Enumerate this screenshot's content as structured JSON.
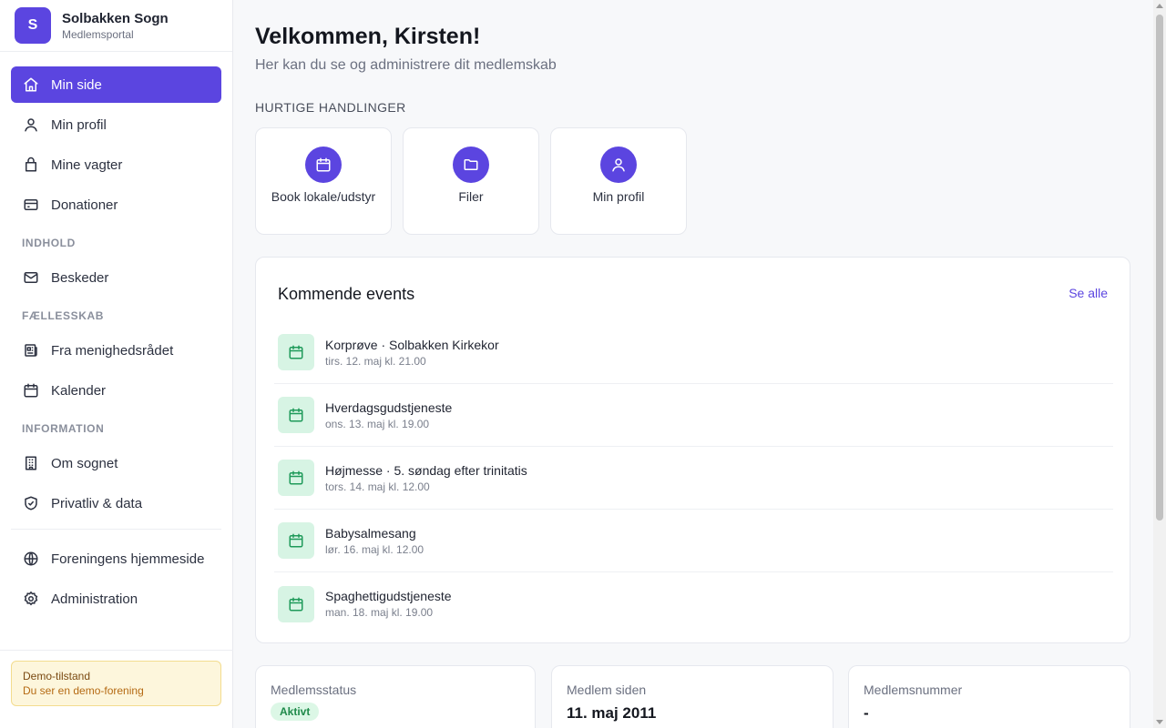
{
  "brand": {
    "initial": "S",
    "name": "Solbakken Sogn",
    "subtitle": "Medlemsportal"
  },
  "nav": {
    "main": [
      {
        "label": "Min side",
        "icon": "home-icon",
        "active": true
      },
      {
        "label": "Min profil",
        "icon": "user-icon"
      },
      {
        "label": "Mine vagter",
        "icon": "bag-icon"
      },
      {
        "label": "Donationer",
        "icon": "credit-card-icon"
      }
    ],
    "sections": [
      {
        "title": "INDHOLD",
        "items": [
          {
            "label": "Beskeder",
            "icon": "mail-icon"
          }
        ]
      },
      {
        "title": "FÆLLESSKAB",
        "items": [
          {
            "label": "Fra menighedsrådet",
            "icon": "newspaper-icon"
          },
          {
            "label": "Kalender",
            "icon": "calendar-icon"
          }
        ]
      },
      {
        "title": "INFORMATION",
        "items": [
          {
            "label": "Om sognet",
            "icon": "building-icon"
          },
          {
            "label": "Privatliv & data",
            "icon": "shield-icon"
          }
        ]
      }
    ],
    "footer": [
      {
        "label": "Foreningens hjemmeside",
        "icon": "globe-icon"
      },
      {
        "label": "Administration",
        "icon": "gear-icon"
      }
    ]
  },
  "demo": {
    "title": "Demo-tilstand",
    "subtitle": "Du ser en demo-forening"
  },
  "page": {
    "title": "Velkommen, Kirsten!",
    "subtitle": "Her kan du se og administrere dit medlemskab"
  },
  "quick_actions": {
    "heading": "HURTIGE HANDLINGER",
    "items": [
      {
        "label": "Book lokale/udstyr",
        "icon": "calendar-icon"
      },
      {
        "label": "Filer",
        "icon": "folder-icon"
      },
      {
        "label": "Min profil",
        "icon": "user-icon"
      }
    ]
  },
  "events": {
    "title": "Kommende events",
    "see_all": "Se alle",
    "items": [
      {
        "name": "Korprøve · Solbakken Kirkekor",
        "date": "tirs. 12. maj kl. 21.00"
      },
      {
        "name": "Hverdagsgudstjeneste",
        "date": "ons. 13. maj kl. 19.00"
      },
      {
        "name": "Højmesse · 5. søndag efter trinitatis",
        "date": "tors. 14. maj kl. 12.00"
      },
      {
        "name": "Babysalmesang",
        "date": "lør. 16. maj kl. 12.00"
      },
      {
        "name": "Spaghettigudstjeneste",
        "date": "man. 18. maj kl. 19.00"
      }
    ]
  },
  "stats": {
    "status": {
      "label": "Medlemsstatus",
      "value": "Aktivt"
    },
    "since": {
      "label": "Medlem siden",
      "value": "11. maj 2011"
    },
    "number": {
      "label": "Medlemsnummer",
      "value": "-"
    }
  },
  "colors": {
    "accent": "#5b45e0",
    "event_icon_bg": "#d7f4e4",
    "event_icon": "#1f9a5a",
    "badge_bg": "#dcf7e6",
    "badge_text": "#1f8a4a"
  }
}
